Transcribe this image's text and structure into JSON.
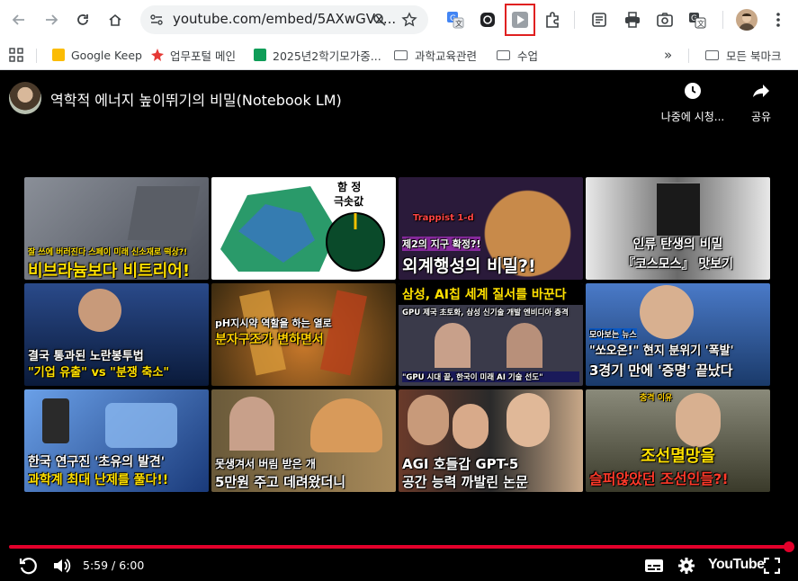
{
  "browser": {
    "url": "youtube.com/embed/5AXwGVx...",
    "bookmarks": [
      {
        "label": "Google Keep",
        "kind": "keep"
      },
      {
        "label": "업무포털 메인",
        "kind": "star"
      },
      {
        "label": "2025년2학기모가중...",
        "kind": "sheet"
      },
      {
        "label": "과학교육관련",
        "kind": "folder"
      },
      {
        "label": "수업",
        "kind": "folder"
      }
    ],
    "more_chevron": "»",
    "all_bookmarks": "모든 북마크"
  },
  "player": {
    "title": "역학적 에너지 높이뛰기의 비밀(Notebook LM)",
    "watch_later_label": "나중에 시청...",
    "share_label": "공유",
    "time": "5:59 / 6:00",
    "progress_fraction": 0.998,
    "brand": "YouTube"
  },
  "videos": [
    {
      "lines": [
        "잘 쓰에 버러진다 스페이 미래 신소재로 떡상?!",
        "비브라늄보다 비트리어!"
      ],
      "bg": "#6b6f78"
    },
    {
      "lines": [
        "함 정",
        "극솟값"
      ],
      "bg": "#2a7a4a"
    },
    {
      "lines": [
        "Trappist 1-d",
        "제2의 지구 확정?!",
        "외계행성의 비밀?!"
      ],
      "bg": "#2a1a3a"
    },
    {
      "lines": [
        "인류 탄생의 비밀",
        "『코스모스』 맛보기"
      ],
      "bg": "#3a3a3a"
    },
    {
      "lines": [
        "결국 통과된 노란봉투법",
        "\"기업 유출\" vs \"분쟁 축소\""
      ],
      "bg": "#1e3a6a"
    },
    {
      "lines": [
        "pH지시약 역할을 하는 열로",
        "분자구조가 변하면서"
      ],
      "bg": "#7a4a1a"
    },
    {
      "lines": [
        "삼성, AI칩 세계 질서를 바꾼다",
        "GPU 제국 초토화, 삼성 신기술 개발 엔비디아 충격",
        "\"GPU 시대 끝, 한국이 미래 AI 기술 선도\""
      ],
      "bg": "#3a3a4a"
    },
    {
      "lines": [
        "모아보는 뉴스",
        "\"쏘오온!\" 현지 분위기 '폭발'",
        "3경기 만에 '증명' 끝났다"
      ],
      "bg": "#1a4a8a"
    },
    {
      "lines": [
        "한국 연구진 '초유의 발견'",
        "과학계 최대 난제를 풀다!!"
      ],
      "bg": "#2a4a7a"
    },
    {
      "lines": [
        "못생겨서 버림 받은 개",
        "5만원 주고 데려왔더니"
      ],
      "bg": "#5a4a2a"
    },
    {
      "lines": [
        "AGI 호들갑 GPT-5",
        "공간 능력 까발린 논문"
      ],
      "bg": "#3a2a2a"
    },
    {
      "lines": [
        "충격 이유",
        "조선멸망을",
        "슬퍼않았던 조선인들?!"
      ],
      "bg": "#4a4a3a"
    }
  ]
}
